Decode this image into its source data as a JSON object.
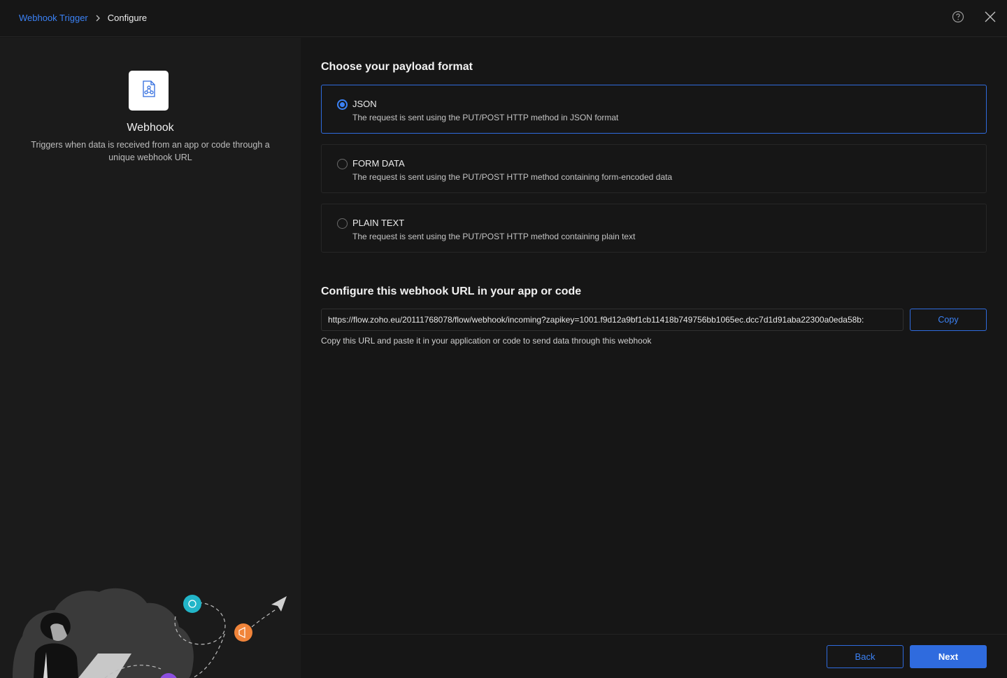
{
  "header": {
    "breadcrumb": {
      "parent": "Webhook Trigger",
      "current": "Configure"
    },
    "icons": [
      "help-icon",
      "close-icon"
    ]
  },
  "left_panel": {
    "app_icon": "webhook-icon",
    "app_name": "Webhook",
    "description": "Triggers when data is received from an app or code through a unique webhook URL"
  },
  "payload": {
    "title": "Choose your payload format",
    "options": [
      {
        "label": "JSON",
        "description": "The request is sent using the PUT/POST HTTP method in JSON format",
        "selected": true
      },
      {
        "label": "FORM DATA",
        "description": "The request is sent using the PUT/POST HTTP method containing form-encoded data",
        "selected": false
      },
      {
        "label": "PLAIN TEXT",
        "description": "The request is sent using the PUT/POST HTTP method containing plain text",
        "selected": false
      }
    ]
  },
  "webhook": {
    "title": "Configure this webhook URL in your app or code",
    "url": "https://flow.zoho.eu/20111768078/flow/webhook/incoming?zapikey=1001.f9d12a9bf1cb11418b749756bb1065ec.dcc7d1d91aba22300a0eda58b:",
    "copy_label": "Copy",
    "help": "Copy this URL and paste it in your application or code to send data through this webhook"
  },
  "footer": {
    "back_label": "Back",
    "next_label": "Next"
  },
  "colors": {
    "accent": "#2f6bde",
    "link": "#3b82f6",
    "background": "#161616",
    "panel": "#1b1b1b"
  }
}
